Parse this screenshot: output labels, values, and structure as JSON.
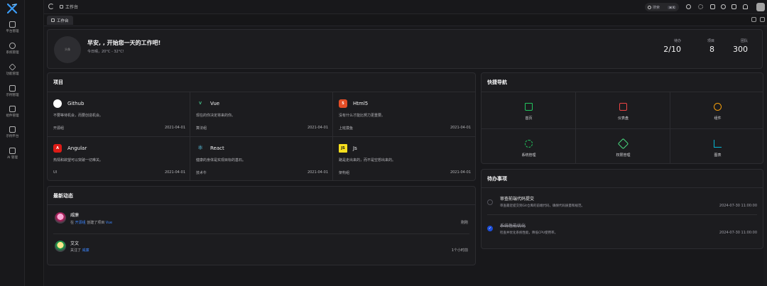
{
  "rail": {
    "items": [
      {
        "label": "平台管理",
        "icon": "platform-icon"
      },
      {
        "label": "系统管理",
        "icon": "system-icon"
      },
      {
        "label": "功能管理",
        "icon": "feature-icon"
      },
      {
        "label": "示例管理",
        "icon": "example-icon"
      },
      {
        "label": "组件管理",
        "icon": "component-icon"
      },
      {
        "label": "示例平台",
        "icon": "demo-icon"
      },
      {
        "label": "AI 管理",
        "icon": "ai-icon"
      }
    ]
  },
  "header": {
    "breadcrumb": "工作台",
    "search_placeholder": "搜索",
    "search_shortcut": "⌘ K"
  },
  "tabs": [
    {
      "label": "工作台"
    }
  ],
  "welcome": {
    "avatar_text": "头像",
    "greeting": "早安, , 开始您一天的工作吧!",
    "weather": "今日晴，20°C - 32°C!",
    "stats": [
      {
        "label": "待办",
        "value": "2/10"
      },
      {
        "label": "项目",
        "value": "8"
      },
      {
        "label": "团队",
        "value": "300"
      }
    ]
  },
  "projects": {
    "title": "项目",
    "items": [
      {
        "name": "Github",
        "desc": "不要等待机会，而要创造机会。",
        "team": "开源组",
        "date": "2021-04-01",
        "icon_text": "",
        "color": "#ffffff"
      },
      {
        "name": "Vue",
        "desc": "现在的你决定将来的你。",
        "team": "算法组",
        "date": "2021-04-01",
        "icon_text": "V",
        "color": "#41b883"
      },
      {
        "name": "Html5",
        "desc": "没有什么才能比努力更重要。",
        "team": "上班摸鱼",
        "date": "2021-04-01",
        "icon_text": "5",
        "color": "#e44d26"
      },
      {
        "name": "Angular",
        "desc": "热情和欲望可以突破一切难关。",
        "team": "UI",
        "date": "2021-04-01",
        "icon_text": "A",
        "color": "#dd1b16"
      },
      {
        "name": "React",
        "desc": "健康的身体是实现目标的基石。",
        "team": "技术牛",
        "date": "2021-04-01",
        "icon_text": "⚛",
        "color": "#61dafb"
      },
      {
        "name": "Js",
        "desc": "路是走出来的，而不是空想出来的。",
        "team": "架构组",
        "date": "2021-04-01",
        "icon_text": "JS",
        "color": "#f7df1e"
      }
    ]
  },
  "activity": {
    "title": "最新动态",
    "items": [
      {
        "name": "威廉",
        "prefix": "在 ",
        "link1": "开源组",
        "middle": " 创建了项目 ",
        "link2": "Vue",
        "time": "刚刚"
      },
      {
        "name": "艾文",
        "prefix": "关注了 ",
        "link1": "威廉",
        "middle": "",
        "link2": "",
        "time": "1个小时前"
      }
    ]
  },
  "quicknav": {
    "title": "快捷导航",
    "items": [
      {
        "label": "首页",
        "icon": "home-icon",
        "color": "#22c55e"
      },
      {
        "label": "仪表盘",
        "icon": "dashboard-icon",
        "color": "#ef4444"
      },
      {
        "label": "组件",
        "icon": "component-icon",
        "color": "#f59e0b"
      },
      {
        "label": "系统管理",
        "icon": "settings-icon",
        "color": "#22c55e"
      },
      {
        "label": "权限管理",
        "icon": "key-icon",
        "color": "#4ade80"
      },
      {
        "label": "图表",
        "icon": "chart-icon",
        "color": "#06b6d4"
      }
    ]
  },
  "todo": {
    "title": "待办事项",
    "items": [
      {
        "title": "审查前端代码提交",
        "desc": "审查最近提交到Git仓库的前端代码，确保代码质量和规范。",
        "date": "2024-07-30 11:00:00",
        "done": false
      },
      {
        "title": "系统性能优化",
        "desc": "检查并优化系统性能，降低CPU使用率。",
        "date": "2024-07-30 11:00:00",
        "done": true
      }
    ]
  },
  "colors": {
    "accent": "#3b82f6",
    "background": "#18181b",
    "card": "#1c1c1f"
  }
}
